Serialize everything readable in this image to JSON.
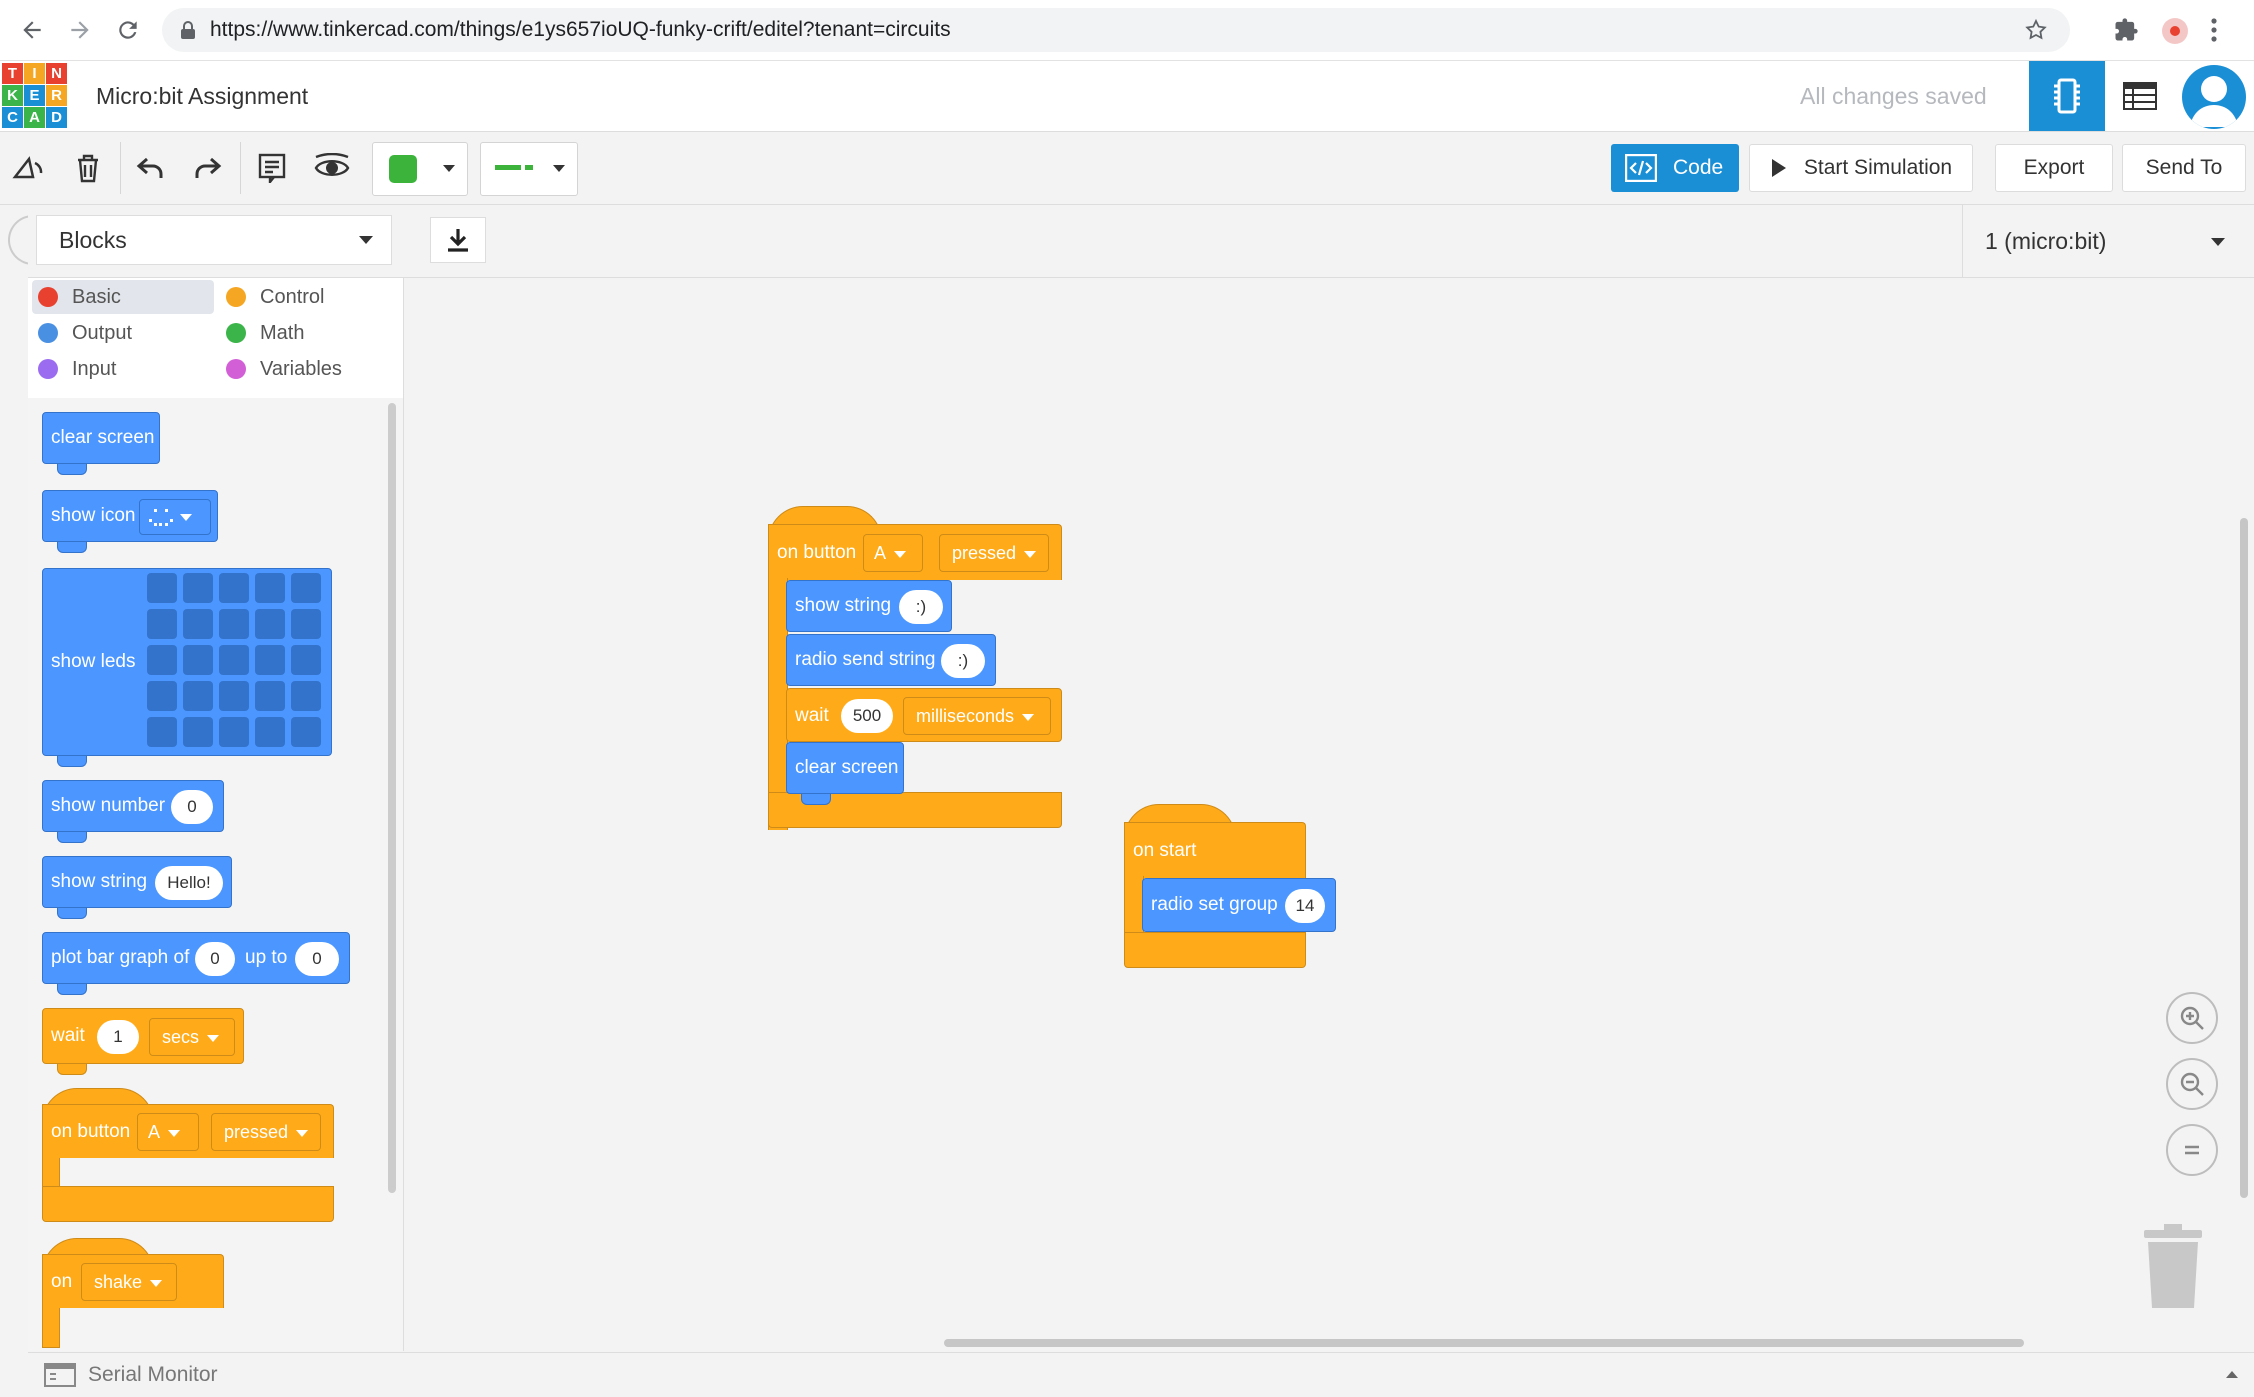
{
  "browser": {
    "url": "https://www.tinkercad.com/things/e1ys657ioUQ-funky-crift/editel?tenant=circuits"
  },
  "app": {
    "logo_letters": [
      "T",
      "I",
      "N",
      "K",
      "E",
      "R",
      "C",
      "A",
      "D"
    ],
    "title": "Micro:bit Assignment",
    "save_status": "All changes saved"
  },
  "toolbar": {
    "code_label": "Code",
    "start_sim_label": "Start Simulation",
    "export_label": "Export",
    "send_to_label": "Send To",
    "fill_color": "#3cb43c"
  },
  "panel": {
    "mode_label": "Blocks",
    "device_label": "1 (micro:bit)"
  },
  "categories": [
    {
      "label": "Basic",
      "color": "#e8412f"
    },
    {
      "label": "Control",
      "color": "#f5a623"
    },
    {
      "label": "Output",
      "color": "#4a90e2"
    },
    {
      "label": "Math",
      "color": "#3bb44a"
    },
    {
      "label": "Input",
      "color": "#9b6cf0"
    },
    {
      "label": "Variables",
      "color": "#d25fd6"
    }
  ],
  "palette": {
    "clear_screen": "clear screen",
    "show_icon": "show icon",
    "show_leds": "show leds",
    "show_number": "show number",
    "show_number_value": "0",
    "show_string": "show string",
    "show_string_value": "Hello!",
    "plot_bar": "plot bar graph of",
    "plot_bar_value": "0",
    "up_to": "up to",
    "up_to_value": "0",
    "wait": "wait",
    "wait_value": "1",
    "wait_unit": "secs",
    "on_button": "on button",
    "on_button_key": "A",
    "on_button_event": "pressed",
    "on": "on",
    "on_event": "shake"
  },
  "workspace": {
    "on_button": "on button",
    "button_key": "A",
    "button_event": "pressed",
    "show_string": "show string",
    "show_string_value": ":)",
    "radio_send_string": "radio send string",
    "radio_send_value": ":)",
    "wait": "wait",
    "wait_value": "500",
    "wait_unit": "milliseconds",
    "clear_screen": "clear screen",
    "on_start": "on start",
    "radio_set_group": "radio set group",
    "radio_group_value": "14"
  },
  "serial": {
    "label": "Serial Monitor"
  }
}
